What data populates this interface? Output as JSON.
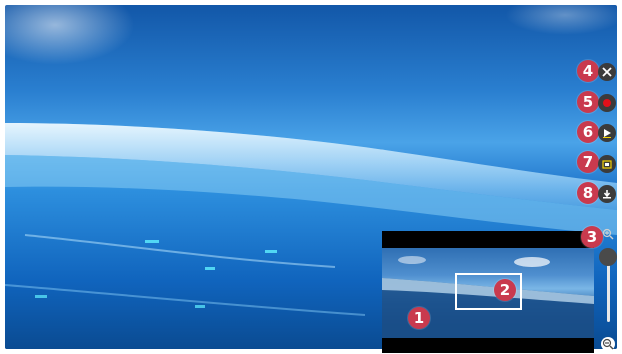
{
  "callouts": {
    "one": "1",
    "two": "2",
    "three": "3",
    "four": "4",
    "five": "5",
    "six": "6",
    "seven": "7",
    "eight": "8"
  },
  "toolbar": {
    "icons": [
      "close-icon",
      "record-icon",
      "play-icon",
      "capture-icon",
      "download-icon"
    ]
  },
  "zoom": {
    "level": 1.0,
    "icons": [
      "zoom-in-icon",
      "zoom-out-icon"
    ]
  },
  "colors": {
    "callout": "#c93a4e",
    "record": "#e0101a",
    "tool_bg": "#3b3b3b"
  }
}
